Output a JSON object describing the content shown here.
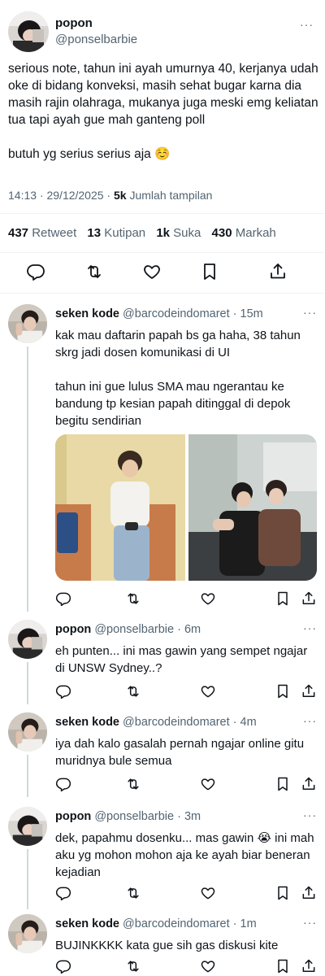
{
  "main_tweet": {
    "name": "popon",
    "handle": "@ponselbarbie",
    "text": "serious note, tahun ini ayah umurnya 40, kerjanya udah oke di bidang konveksi, masih sehat bugar karna dia masih rajin olahraga, mukanya juga meski emg keliatan tua tapi ayah gue mah ganteng poll\n\nbutuh yg serius serius aja ☺️",
    "time": "14:13 · 29/12/2025 · ",
    "views_count": "5k",
    "views_label": "Jumlah tampilan",
    "stats": [
      {
        "count": "437",
        "label": "Retweet"
      },
      {
        "count": "13",
        "label": "Kutipan"
      },
      {
        "count": "1k",
        "label": "Suka"
      },
      {
        "count": "430",
        "label": "Markah"
      }
    ]
  },
  "replies": [
    {
      "name": "seken kode",
      "handle": "@barcodeindomaret · 15m",
      "text": "kak mau daftarin papah bs ga haha, 38 tahun skrg jadi dosen komunikasi di UI\n\ntahun ini gue lulus SMA mau ngerantau ke bandung tp kesian papah ditinggal di depok begitu sendirian"
    },
    {
      "name": "popon",
      "handle": "@ponselbarbie · 6m",
      "text": "eh punten... ini mas gawin yang sempet ngajar di UNSW Sydney..?"
    },
    {
      "name": "seken kode",
      "handle": "@barcodeindomaret · 4m",
      "text": "iya dah kalo gasalah pernah ngajar online gitu muridnya bule semua"
    },
    {
      "name": "popon",
      "handle": "@ponselbarbie · 3m",
      "text": "dek, papahmu dosenku... mas gawin 😭 ini mah aku yg mohon mohon aja ke ayah biar beneran kejadian"
    },
    {
      "name": "seken kode",
      "handle": "@barcodeindomaret · 1m",
      "text": "BUJINKKKK kata gue sih gas diskusi kite"
    }
  ],
  "more_glyph": "···",
  "colors": {
    "text": "#0f1419",
    "secondary": "#536471",
    "divider": "#eff3f4",
    "thread": "#cfd9de"
  }
}
